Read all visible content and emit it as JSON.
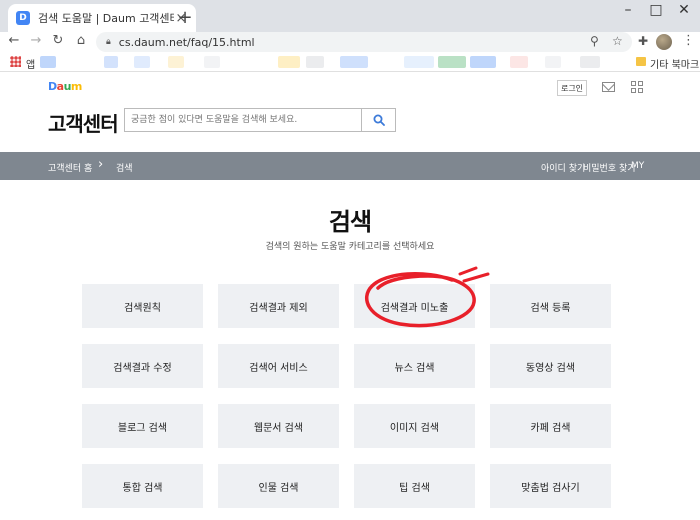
{
  "browser": {
    "tab_favicon": "D",
    "tab_title": "검색 도움말 | Daum 고객센터",
    "tab_close": "×",
    "new_tab": "+",
    "url": "cs.daum.net/faq/15.html",
    "bookmark_apps": "앱",
    "bookmark_other": "기타 북마크"
  },
  "header": {
    "logo": [
      "D",
      "a",
      "u",
      "m"
    ],
    "logo_colors": [
      "#4285f4",
      "#ea4335",
      "#34a853",
      "#fbbc05"
    ],
    "title": "고객센터",
    "search_placeholder": "궁금한 점이 있다면 도움말을 검색해 보세요.",
    "login": "로그인"
  },
  "navbar": {
    "home": "고객센터 홈",
    "separator": "›",
    "current": "검색",
    "links": [
      "아이디 찾기",
      "비밀번호 찾기",
      "MY"
    ]
  },
  "main": {
    "heading": "검색",
    "subheading": "검색의 원하는 도움말 카테고리를 선택하세요",
    "categories": [
      [
        "검색원칙",
        "검색결과 제외",
        "검색결과 미노출",
        "검색 등록"
      ],
      [
        "검색결과 수정",
        "검색어 서비스",
        "뉴스 검색",
        "동영상 검색"
      ],
      [
        "블로그 검색",
        "웹문서 검색",
        "이미지 검색",
        "카페 검색"
      ],
      [
        "통합 검색",
        "인물 검색",
        "팁 검색",
        "맞춤법 검사기"
      ]
    ]
  },
  "colors": {
    "navbar_bg": "#7f8790",
    "button_bg": "#eef0f3",
    "annotation": "#e8202a",
    "search_icon": "#3d7bd9"
  }
}
